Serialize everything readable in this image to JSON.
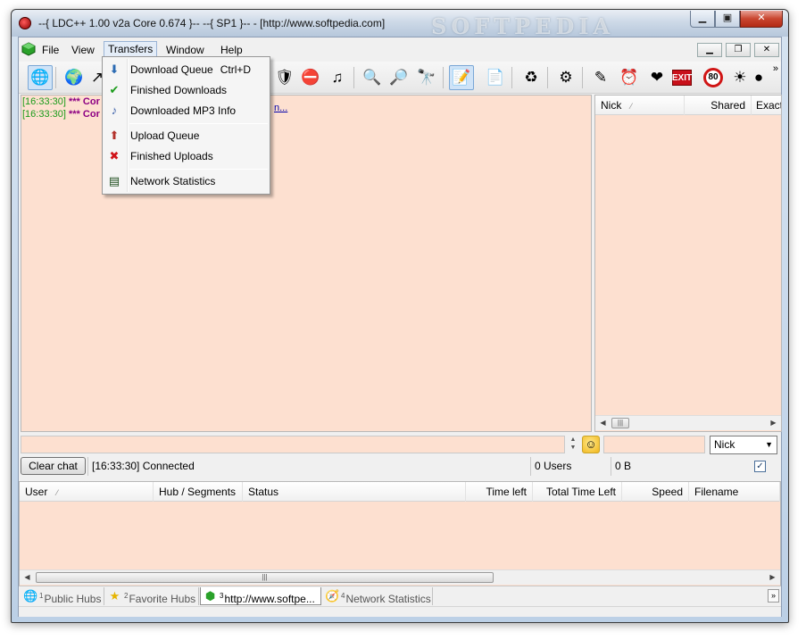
{
  "window": {
    "title": "--{ LDC++ 1.00 v2a Core 0.674 }--  --{  SP1 }-- - [http://www.softpedia.com]",
    "watermark": "SOFTPEDIA",
    "min_label": "▁",
    "max_label": "▣",
    "close_label": "✕"
  },
  "menubar": {
    "items": [
      "File",
      "View",
      "Transfers",
      "Window",
      "Help"
    ],
    "mdi": {
      "min": "▁",
      "restore": "❐",
      "close": "✕"
    }
  },
  "toolbar": {
    "more": "»",
    "buttons": [
      {
        "icon": "🌐",
        "name": "public-hubs-icon"
      },
      {
        "icon": "🌍",
        "name": "reconnect-icon"
      },
      {
        "icon": "↗",
        "name": "follow-redirect-icon"
      },
      {
        "icon": "🛡",
        "name": "favorite-users-icon"
      },
      {
        "icon": "⛔",
        "name": "ignored-users-icon"
      },
      {
        "icon": "♫",
        "name": "mp3-icon"
      },
      {
        "icon": "🔍",
        "name": "search-icon"
      },
      {
        "icon": "🔎",
        "name": "search-spy-icon"
      },
      {
        "icon": "🔭",
        "name": "adl-search-icon"
      },
      {
        "icon": "📝",
        "name": "notepad-icon"
      },
      {
        "icon": "📄",
        "name": "file-list-icon"
      },
      {
        "icon": "♻",
        "name": "refresh-icon"
      },
      {
        "icon": "⚙",
        "name": "settings-icon"
      },
      {
        "icon": "👥",
        "name": "users-icon"
      },
      {
        "icon": "✎",
        "name": "edit-icon"
      },
      {
        "icon": "⏰",
        "name": "clock-icon"
      },
      {
        "icon": "❤",
        "name": "heart-icon"
      },
      {
        "icon": "EXIT",
        "name": "exit-icon"
      },
      {
        "icon": "80",
        "name": "speed-limit-icon"
      },
      {
        "icon": "☀",
        "name": "away-icon"
      },
      {
        "icon": "●",
        "name": "extra-icon"
      }
    ]
  },
  "chat": {
    "lines": [
      {
        "time": "[16:33:30]",
        "stars": "***",
        "msg": "Cor"
      },
      {
        "time": "[16:33:30]",
        "stars": "***",
        "msg": "Cor"
      }
    ],
    "link": "n..."
  },
  "users": {
    "columns": [
      "Nick",
      "Shared",
      "Exact"
    ],
    "sort_arrow": "⁄"
  },
  "input_row": {
    "spin_up": "▲",
    "spin_down": "▼",
    "smiley": "☺",
    "nick_option": "Nick",
    "nick_arrow": "▼"
  },
  "status": {
    "clear_chat": "Clear chat",
    "message": "[16:33:30] Connected",
    "users": "0 Users",
    "shared": "0 B",
    "check": "✓"
  },
  "transfers": {
    "columns": [
      "User",
      "Hub / Segments",
      "Status",
      "Time left",
      "Total Time Left",
      "Speed",
      "Filename"
    ],
    "sort_arrow": "⁄"
  },
  "scroll": {
    "left": "◀",
    "right": "▶",
    "grip": "|||"
  },
  "tabs": [
    {
      "num": "1",
      "label": "Public Hubs",
      "icon": "🌐"
    },
    {
      "num": "2",
      "label": "Favorite Hubs",
      "icon": "★"
    },
    {
      "num": "3",
      "label": "http://www.softpe...",
      "icon": "⬢"
    },
    {
      "num": "4",
      "label": "Network Statistics",
      "icon": "🧭"
    }
  ],
  "tabs_more": "»",
  "dropdown": {
    "items": [
      {
        "label": "Download Queue",
        "shortcut": "Ctrl+D",
        "icon": "⬇"
      },
      {
        "label": "Finished Downloads",
        "shortcut": "",
        "icon": "✔"
      },
      {
        "label": "Downloaded MP3 Info",
        "shortcut": "",
        "icon": "♪"
      },
      {
        "label": "Upload Queue",
        "shortcut": "",
        "icon": "⬆"
      },
      {
        "label": "Finished Uploads",
        "shortcut": "",
        "icon": "✖"
      },
      {
        "label": "Network Statistics",
        "shortcut": "",
        "icon": "▤"
      }
    ]
  },
  "colors": {
    "panel_bg": "#fde0d0",
    "chat_time": "#1a9b1a",
    "chat_msg": "#8d0083"
  }
}
